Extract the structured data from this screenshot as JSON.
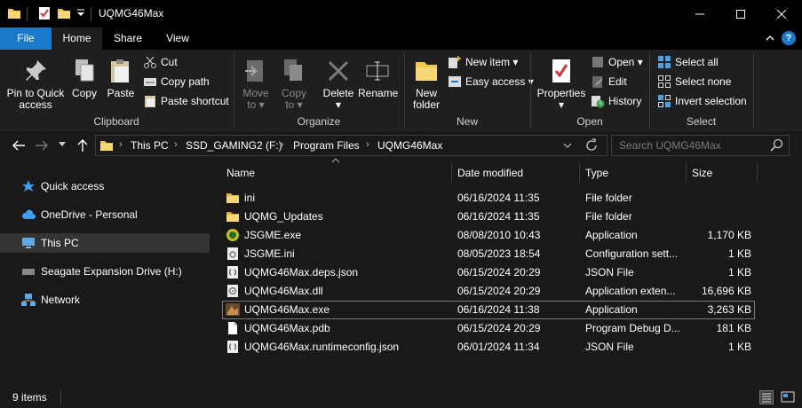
{
  "window": {
    "title": "UQMG46Max"
  },
  "tabs": [
    "File",
    "Home",
    "Share",
    "View"
  ],
  "ribbon": {
    "clipboard": {
      "label": "Clipboard",
      "pin": "Pin to Quick access",
      "copy": "Copy",
      "paste": "Paste",
      "cut": "Cut",
      "copy_path": "Copy path",
      "paste_shortcut": "Paste shortcut"
    },
    "organize": {
      "label": "Organize",
      "move_to_1": "Move",
      "move_to_2": "to",
      "copy_to_1": "Copy",
      "copy_to_2": "to",
      "delete": "Delete",
      "rename": "Rename"
    },
    "new": {
      "label": "New",
      "new_folder_1": "New",
      "new_folder_2": "folder",
      "new_item": "New item",
      "easy_access": "Easy access"
    },
    "open": {
      "label": "Open",
      "properties": "Properties",
      "open": "Open",
      "edit": "Edit",
      "history": "History"
    },
    "select": {
      "label": "Select",
      "select_all": "Select all",
      "select_none": "Select none",
      "invert": "Invert selection"
    }
  },
  "address": {
    "crumbs": [
      "This PC",
      "SSD_GAMING2 (F:)",
      "Program Files",
      "UQMG46Max"
    ],
    "search_placeholder": "Search UQMG46Max"
  },
  "nav": {
    "items": [
      "Quick access",
      "OneDrive - Personal",
      "This PC",
      "Seagate Expansion Drive (H:)",
      "Network"
    ]
  },
  "columns": {
    "name": "Name",
    "date": "Date modified",
    "type": "Type",
    "size": "Size"
  },
  "files": [
    {
      "name": "ini",
      "date": "06/16/2024 11:35",
      "type": "File folder",
      "size": "",
      "icon": "folder-icon"
    },
    {
      "name": "UQMG_Updates",
      "date": "06/16/2024 11:35",
      "type": "File folder",
      "size": "",
      "icon": "folder-icon"
    },
    {
      "name": "JSGME.exe",
      "date": "08/08/2010 10:43",
      "type": "Application",
      "size": "1,170 KB",
      "icon": "jsgme-app-icon"
    },
    {
      "name": "JSGME.ini",
      "date": "08/05/2023 18:54",
      "type": "Configuration sett...",
      "size": "1 KB",
      "icon": "config-file-icon"
    },
    {
      "name": "UQMG46Max.deps.json",
      "date": "06/15/2024 20:29",
      "type": "JSON File",
      "size": "1 KB",
      "icon": "json-file-icon"
    },
    {
      "name": "UQMG46Max.dll",
      "date": "06/15/2024 20:29",
      "type": "Application exten...",
      "size": "16,696 KB",
      "icon": "dll-file-icon"
    },
    {
      "name": "UQMG46Max.exe",
      "date": "06/16/2024 11:38",
      "type": "Application",
      "size": "3,263 KB",
      "icon": "uqmg-app-icon"
    },
    {
      "name": "UQMG46Max.pdb",
      "date": "06/15/2024 20:29",
      "type": "Program Debug D...",
      "size": "181 KB",
      "icon": "blank-file-icon"
    },
    {
      "name": "UQMG46Max.runtimeconfig.json",
      "date": "06/01/2024 11:34",
      "type": "JSON File",
      "size": "1 KB",
      "icon": "json-file-icon"
    }
  ],
  "status": {
    "count": "9 items"
  },
  "colors": {
    "accent": "#1979ca",
    "folder": "#f4c84a",
    "background": "#191919"
  }
}
